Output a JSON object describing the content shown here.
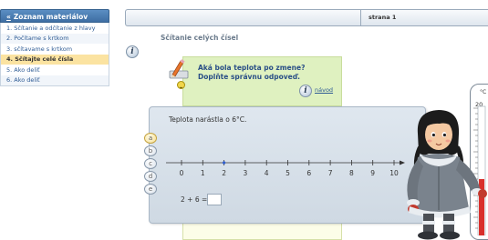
{
  "sidebar": {
    "back_symbol": "«",
    "title": "Zoznam materiálov",
    "items": [
      {
        "label": "1. Sčítanie a odčítanie z hlavy"
      },
      {
        "label": "2. Počítame s krtkom"
      },
      {
        "label": "3. sčítavame s krtkom"
      },
      {
        "label": "4. Sčítajte celé čísla"
      },
      {
        "label": "5. Ako deliť"
      },
      {
        "label": "6. Ako deliť"
      }
    ]
  },
  "header": {
    "page_label": "strana  1"
  },
  "section_title": "Sčítanie celých čísel",
  "icons": {
    "info": "i",
    "info_left": "info-icon",
    "pencil": "pencil-icon",
    "smiley": "smiley-icon"
  },
  "task": {
    "line1": "Aká bola teplota po zmene?",
    "line2": "Doplňte správnu odpoveď.",
    "navod_label": "návod"
  },
  "exercise": {
    "statement": "Teplota narástla o 6°C.",
    "options": [
      "a",
      "b",
      "c",
      "d",
      "e"
    ],
    "selected_option": "a",
    "number_line": {
      "ticks": [
        0,
        1,
        2,
        3,
        4,
        5,
        6,
        7,
        8,
        9,
        10
      ],
      "marked_value": 2
    },
    "equation": "2 + 6 =",
    "answer_value": ""
  },
  "thermometer": {
    "unit": "°C",
    "top_label": "20"
  },
  "colors": {
    "sidebar_header": "#4a7db3",
    "active_item": "#fbe3a1",
    "task_panel": "#dff1c0",
    "work_panel": "#d6dfe8",
    "link": "#2f5c95"
  }
}
